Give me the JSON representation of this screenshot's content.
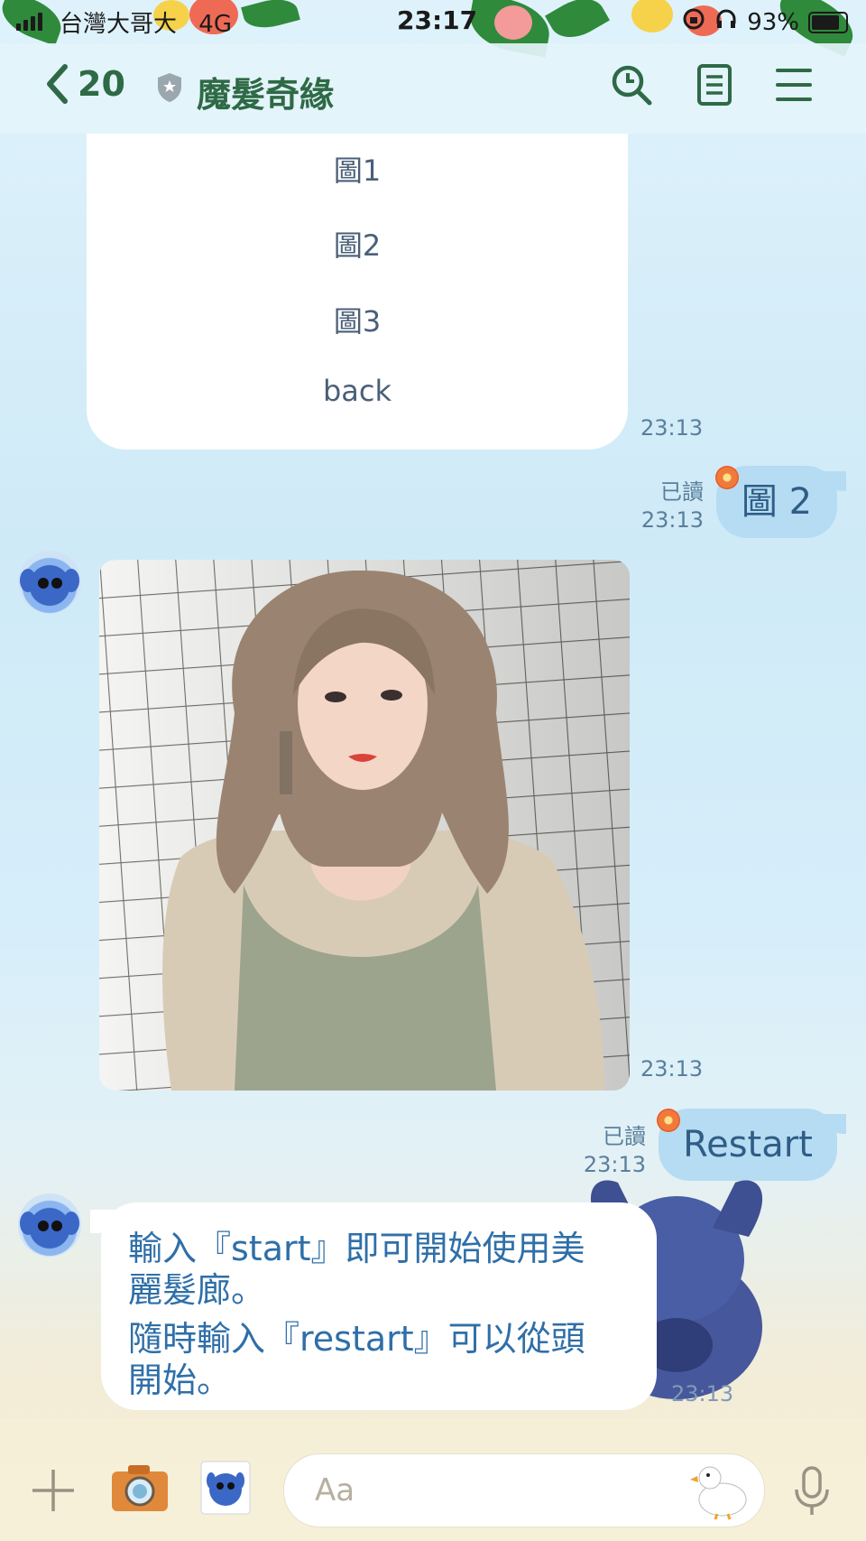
{
  "status_bar": {
    "carrier": "台灣大哥大",
    "network": "4G",
    "time": "23:17",
    "battery": "93%"
  },
  "header": {
    "back_count": "20",
    "title": "魔髮奇緣"
  },
  "messages": {
    "menu_options": [
      "圖1",
      "圖2",
      "圖3",
      "back"
    ],
    "menu_time": "23:13",
    "sent1": {
      "read": "已讀",
      "time": "23:13",
      "text": "圖 2"
    },
    "image_time": "23:13",
    "sent2": {
      "read": "已讀",
      "time": "23:13",
      "text": "Restart"
    },
    "reply_lines": [
      "輸入『start』即可開始使用美",
      "麗髮廊。",
      "隨時輸入『restart』可以從頭",
      "開始。"
    ],
    "reply_time": "23:13"
  },
  "composer": {
    "placeholder": "Aa"
  },
  "icons": {
    "back": "chevron-left-icon",
    "shield": "shield-icon",
    "search": "search-icon",
    "notes": "notes-icon",
    "menu": "menu-icon",
    "plus": "plus-icon",
    "camera": "camera-icon",
    "sticker": "sticker-icon",
    "duck": "duck-sticker-icon",
    "mic": "microphone-icon"
  },
  "colors": {
    "accent_green": "#2e6a45",
    "sent_bubble": "#b6dcf3",
    "text_blue": "#2f5d86"
  }
}
